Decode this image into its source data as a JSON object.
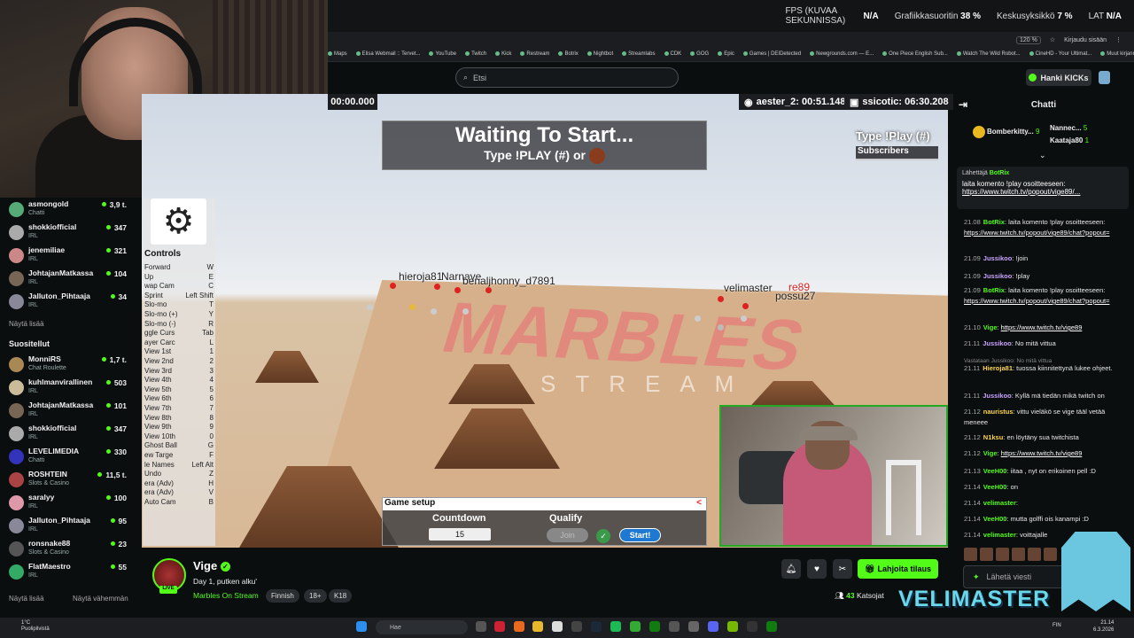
{
  "fps_overlay": {
    "fps_label": "FPS (KUVAA SEKUNNISSA)",
    "fps_value": "N/A",
    "gpu_label": "Grafiikkasuoritin",
    "gpu_value": "38 %",
    "cpu_label": "Keskusyksikkö",
    "cpu_value": "7 %",
    "lat_label": "LAT",
    "lat_value": "N/A"
  },
  "browser": {
    "zoom": "120 %",
    "signin": "Kirjaudu sisään",
    "bookmarks": [
      "Maps",
      "Elisa Webmail :: Tervet...",
      "YouTube",
      "Twitch",
      "Kick",
      "Restream",
      "Botrix",
      "Nightbot",
      "Streamlabs",
      "CDK",
      "GOG",
      "Epic",
      "Games | DEIDetected",
      "Newgrounds.com — E...",
      "One Piece English Sub...",
      "Watch The Wild Robot...",
      "CineHD - Your Ultimat...",
      "Muut kirjanmerkit"
    ]
  },
  "topbar": {
    "search_placeholder": "Etsi",
    "hanki_label": "Hanki KICKs"
  },
  "sidebar": {
    "following": [
      {
        "name": "asmongold",
        "category": "Chatti",
        "viewers": "3,9 t.",
        "color": "#5a7"
      },
      {
        "name": "shokkiofficial",
        "category": "IRL",
        "viewers": "347",
        "color": "#aaa"
      },
      {
        "name": "jenemiliae",
        "category": "IRL",
        "viewers": "321",
        "color": "#c88"
      },
      {
        "name": "JohtajanMatkassa",
        "category": "IRL",
        "viewers": "104",
        "color": "#765"
      },
      {
        "name": "Jalluton_Pihtaaja",
        "category": "IRL",
        "viewers": "34",
        "color": "#889"
      }
    ],
    "show_more": "Näytä lisää",
    "recommended_heading": "Suositellut",
    "recommended": [
      {
        "name": "MonniRS",
        "category": "Chat Roulette",
        "viewers": "1,7 t.",
        "color": "#a85"
      },
      {
        "name": "kuhlmanvirallinen",
        "category": "IRL",
        "viewers": "503",
        "color": "#cb9"
      },
      {
        "name": "JohtajanMatkassa",
        "category": "IRL",
        "viewers": "101",
        "color": "#765"
      },
      {
        "name": "shokkiofficial",
        "category": "IRL",
        "viewers": "347",
        "color": "#aaa"
      },
      {
        "name": "LEVELIMEDIA",
        "category": "Chatti",
        "viewers": "330",
        "color": "#33b"
      },
      {
        "name": "ROSHTEIN",
        "category": "Slots & Casino",
        "viewers": "11,5 t.",
        "color": "#a44"
      },
      {
        "name": "saralyy",
        "category": "IRL",
        "viewers": "100",
        "color": "#d9a"
      },
      {
        "name": "Jalluton_Pihtaaja",
        "category": "IRL",
        "viewers": "95",
        "color": "#889"
      },
      {
        "name": "ronsnake88",
        "category": "Slots & Casino",
        "viewers": "23",
        "color": "#555"
      },
      {
        "name": "FlatMaestro",
        "category": "IRL",
        "viewers": "55",
        "color": "#3a6"
      }
    ],
    "show_more2": "Näytä lisää",
    "show_less": "Näytä vähemmän"
  },
  "game": {
    "timer_left": "00:00.000",
    "timer_best": "aester_2: 00:51.148",
    "timer_top": "ssicotic: 06:30.208",
    "waiting_title": "Waiting To Start...",
    "waiting_sub": "Type !PLAY (#) or",
    "type_play": "Type !Play (#)",
    "subscribers": "Subscribers",
    "settings_label": "Settings",
    "controls_title": "Controls",
    "controls": [
      [
        "Forward",
        "W"
      ],
      [
        "Up",
        "E"
      ],
      [
        "wap Cam",
        "C"
      ],
      [
        "Sprint",
        "Left Shift"
      ],
      [
        "Slo-mo",
        "T"
      ],
      [
        "Slo-mo (+)",
        "Y"
      ],
      [
        "Slo-mo (-)",
        "R"
      ],
      [
        "ggle Curs",
        "Tab"
      ],
      [
        "ayer Carc",
        "L"
      ],
      [
        "View 1st",
        "1"
      ],
      [
        "View 2nd",
        "2"
      ],
      [
        "View 3rd",
        "3"
      ],
      [
        "View 4th",
        "4"
      ],
      [
        "View 5th",
        "5"
      ],
      [
        "View 6th",
        "6"
      ],
      [
        "View 7th",
        "7"
      ],
      [
        "View 8th",
        "8"
      ],
      [
        "View 9th",
        "9"
      ],
      [
        "View 10th",
        "0"
      ],
      [
        "Ghost Ball",
        "G"
      ],
      [
        "ew Targe",
        "F"
      ],
      [
        "le Names",
        "Left Alt"
      ],
      [
        "Undo",
        "Z"
      ],
      [
        "era (Adv)",
        "H"
      ],
      [
        "era (Adv)",
        "V"
      ],
      [
        "Auto Cam",
        "B"
      ]
    ],
    "player_labels": [
      "hieroja81",
      "Narnaye",
      "benaljhonny_d7891",
      "velimaster",
      "re89",
      "possu27"
    ],
    "floor_word": "MARBLES",
    "floor_sub": "STREAM",
    "setup_title": "Game setup",
    "setup_close": "<",
    "countdown_label": "Countdown",
    "countdown_value": "15",
    "qualify_label": "Qualify",
    "join_label": "Join",
    "start_label": "Start!"
  },
  "channel": {
    "name": "Vige",
    "live": "LIVE",
    "title": "Day 1, putken alku'",
    "category": "Marbles On Stream",
    "tags": [
      "Finnish",
      "18+",
      "K18"
    ],
    "subscribe_label": "Lahjoita tilaus",
    "viewers_count": "43",
    "viewers_label": "Katsojat"
  },
  "chat": {
    "title": "Chatti",
    "gifters": [
      {
        "name": "Bomberkitty...",
        "count": "9"
      },
      {
        "name": "Nannec...",
        "count": "5"
      },
      {
        "name": "Kaataja80",
        "count": "1"
      }
    ],
    "pinned_header_label": "Lähettäjä",
    "pinned_header_user": "BotRix",
    "pinned_text": "laita komento !play osoitteeseen:",
    "pinned_link": "https://www.twitch.tv/popout/vige89/...",
    "messages": [
      {
        "time": "21.08",
        "user": "BotRix",
        "color": "#53fc18",
        "text": "laita komento !play osoitteeseen: ",
        "link": "https://www.twitch.tv/popout/vige89/chat?popout="
      },
      {
        "time": "21.09",
        "user": "Jussikoo",
        "color": "#c9a4ff",
        "text": "!join"
      },
      {
        "time": "21.09",
        "user": "Jussikoo",
        "color": "#c9a4ff",
        "text": "!play"
      },
      {
        "time": "21.09",
        "user": "BotRix",
        "color": "#53fc18",
        "text": "laita komento !play osoitteeseen: ",
        "link": "https://www.twitch.tv/popout/vige89/chat?popout="
      },
      {
        "time": "21.10",
        "user": "Vige",
        "color": "#53fc18",
        "text": "",
        "link": "https://www.twitch.tv/vige89"
      },
      {
        "time": "21.11",
        "user": "Jussikoo",
        "color": "#c9a4ff",
        "text": "No mitä vittua"
      },
      {
        "time": "",
        "user": "",
        "color": "#888",
        "text": "Vastataan Jussikoo: No mitä vittua"
      },
      {
        "time": "21.11",
        "user": "Hieroja81",
        "color": "#ffd54a",
        "text": "tuossa kiinnitettynä lukee ohjeet."
      },
      {
        "time": "21.11",
        "user": "Jussikoo",
        "color": "#c9a4ff",
        "text": "Kyllä mä tiedän mikä twitch on"
      },
      {
        "time": "21.12",
        "user": "nauristus",
        "color": "#ffd54a",
        "text": "vittu vieläkö se vige tääl vetää meneee"
      },
      {
        "time": "21.12",
        "user": "N1ksu",
        "color": "#ffd54a",
        "text": "en löytäny sua twitchista"
      },
      {
        "time": "21.12",
        "user": "Vige",
        "color": "#53fc18",
        "text": "",
        "link": "https://www.twitch.tv/vige89"
      },
      {
        "time": "21.13",
        "user": "VeeH00",
        "color": "#53fc18",
        "text": "iitaa , nyt on erikoinen pell :D"
      },
      {
        "time": "21.14",
        "user": "VeeH00",
        "color": "#53fc18",
        "text": "on"
      },
      {
        "time": "21.14",
        "user": "velimaster",
        "color": "#53fc18",
        "text": ""
      },
      {
        "time": "21.14",
        "user": "VeeH00",
        "color": "#53fc18",
        "text": "mutta golffi ois kanampi :D"
      },
      {
        "time": "21.14",
        "user": "velimaster",
        "color": "#53fc18",
        "text": "voittajalle"
      }
    ],
    "input_placeholder": "Lähetä viesti"
  },
  "overlay": {
    "velimaster_text": "VELIMASTER"
  },
  "taskbar": {
    "weather_temp": "1°C",
    "weather_desc": "Puolipilvistä",
    "search_placeholder": "Hae",
    "lang": "FIN",
    "time": "21.14",
    "date": "6.3.2026"
  }
}
